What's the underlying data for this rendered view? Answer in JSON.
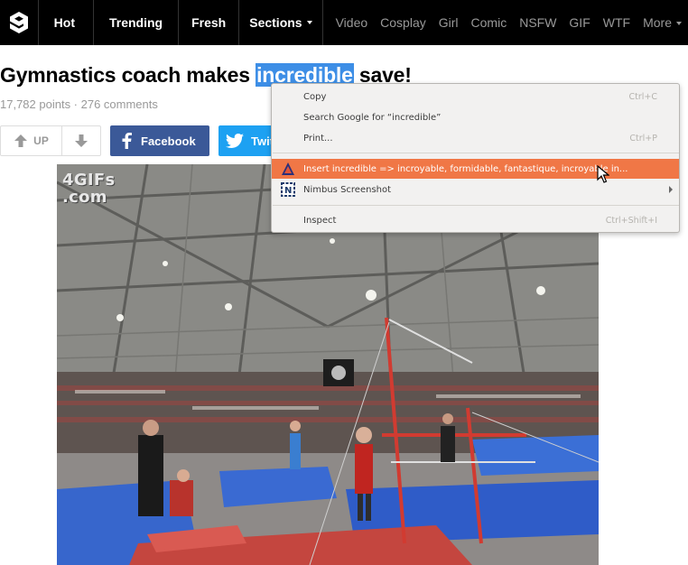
{
  "nav": {
    "logo_icon": "9gag-logo-icon",
    "main": [
      {
        "label": "Hot"
      },
      {
        "label": "Trending"
      },
      {
        "label": "Fresh"
      },
      {
        "label": "Sections"
      }
    ],
    "sections": [
      "Video",
      "Cosplay",
      "Girl",
      "Comic",
      "NSFW",
      "GIF",
      "WTF",
      "More"
    ]
  },
  "post": {
    "title_before": "Gymnastics coach makes ",
    "title_highlight": "incredible",
    "title_after": " save!",
    "meta": "17,782 points · 276 comments",
    "upvote_label": "UP",
    "facebook_label": "Facebook",
    "twitter_label": "Twitter",
    "watermark_line1": "4GIFs",
    "watermark_line2": ".com"
  },
  "context_menu": {
    "items": [
      {
        "label": "Copy",
        "shortcut": "Ctrl+C"
      },
      {
        "label": "Search Google for “incredible”",
        "shortcut": ""
      },
      {
        "label": "Print...",
        "shortcut": "Ctrl+P"
      },
      {
        "label": "Insert incredible => incroyable, formidable, fantastique, incroyable in...",
        "shortcut": ""
      },
      {
        "label": "Nimbus Screenshot",
        "shortcut": ""
      },
      {
        "label": "Inspect",
        "shortcut": "Ctrl+Shift+I"
      }
    ]
  },
  "colors": {
    "nav_bg": "#000000",
    "highlight": "#3d8ee6",
    "facebook": "#3b5998",
    "twitter": "#1da1f2",
    "menu_highlight": "#f07746"
  }
}
